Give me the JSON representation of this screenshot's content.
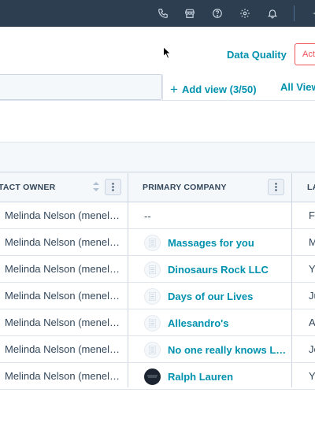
{
  "top_nav": {
    "icons": [
      "phone-icon",
      "marketplace-icon",
      "help-icon",
      "settings-icon",
      "notifications-icon",
      "sparkle-icon"
    ]
  },
  "header": {
    "data_quality_label": "Data Quality",
    "actions_label": "Acti"
  },
  "views": {
    "add_view_label": "Add view (3/50)",
    "all_views_label": "All View"
  },
  "table": {
    "columns": {
      "owner": "TACT OWNER",
      "company": "PRIMARY COMPANY",
      "last": "LA"
    },
    "rows": [
      {
        "owner": "Melinda Nelson (menel…",
        "company": "--",
        "company_logo": "none",
        "last": "Fe"
      },
      {
        "owner": "Melinda Nelson (menel…",
        "company": "Massages for you",
        "company_logo": "placeholder",
        "last": "M"
      },
      {
        "owner": "Melinda Nelson (menel…",
        "company": "Dinosaurs Rock LLC",
        "company_logo": "placeholder",
        "last": "Ye"
      },
      {
        "owner": "Melinda Nelson (menel…",
        "company": "Days of our Lives",
        "company_logo": "placeholder",
        "last": "Ju"
      },
      {
        "owner": "Melinda Nelson (menel…",
        "company": "Allesandro's",
        "company_logo": "placeholder",
        "last": "A"
      },
      {
        "owner": "Melinda Nelson (menel…",
        "company": "No one really knows L…",
        "company_logo": "placeholder",
        "last": "Je"
      },
      {
        "owner": "Melinda Nelson (menel…",
        "company": "Ralph Lauren",
        "company_logo": "brand-dark",
        "last": "Ye"
      }
    ]
  },
  "colors": {
    "nav_bg": "#2d3e50",
    "link": "#0091ae",
    "text": "#33475b",
    "action_accent": "#f2545b",
    "header_bg": "#f5f8fa"
  }
}
